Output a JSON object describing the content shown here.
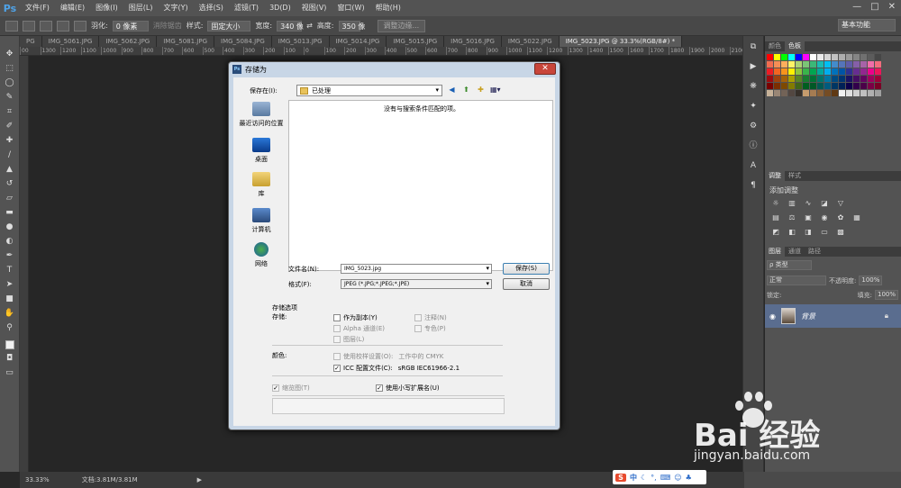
{
  "app": {
    "logo": "Ps"
  },
  "menu": [
    "文件(F)",
    "编辑(E)",
    "图像(I)",
    "图层(L)",
    "文字(Y)",
    "选择(S)",
    "滤镜(T)",
    "3D(D)",
    "视图(V)",
    "窗口(W)",
    "帮助(H)"
  ],
  "window_controls": [
    "—",
    "□",
    "✕"
  ],
  "options_bar": {
    "feather_label": "羽化:",
    "feather_value": "0 像素",
    "antialias_label": "消除锯齿",
    "style_label": "样式:",
    "style_value": "固定大小",
    "width_label": "宽度:",
    "width_value": "340 像",
    "height_label": "高度:",
    "height_value": "350 像",
    "refine_button": "调整边缘...",
    "workspace": "基本功能"
  },
  "tabs": [
    {
      "label": "PG",
      "active": false
    },
    {
      "label": "IMG_5061.JPG",
      "active": false
    },
    {
      "label": "IMG_5062.JPG",
      "active": false
    },
    {
      "label": "IMG_5081.JPG",
      "active": false
    },
    {
      "label": "IMG_5084.JPG",
      "active": false
    },
    {
      "label": "IMG_5013.JPG",
      "active": false
    },
    {
      "label": "IMG_5014.JPG",
      "active": false
    },
    {
      "label": "IMG_5015.JPG",
      "active": false
    },
    {
      "label": "IMG_5016.JPG",
      "active": false
    },
    {
      "label": "IMG_5022.JPG",
      "active": false
    },
    {
      "label": "IMG_5023.JPG @ 33.3%(RGB/8#) *",
      "active": true
    }
  ],
  "ruler_ticks": [
    "00",
    "1300",
    "1200",
    "1100",
    "1000",
    "900",
    "800",
    "700",
    "600",
    "500",
    "400",
    "300",
    "200",
    "100",
    "0",
    "100",
    "200",
    "300",
    "400",
    "500",
    "600",
    "700",
    "800",
    "900",
    "1000",
    "1100",
    "1200",
    "1300",
    "1400",
    "1500",
    "1600",
    "1700",
    "1800",
    "1900",
    "2000",
    "2100"
  ],
  "status": {
    "zoom": "33.33%",
    "doc": "文档:3.81M/3.81M"
  },
  "panels": {
    "swatches_tabs": [
      "颜色",
      "色板"
    ],
    "adjust_tabs": [
      "调整",
      "样式"
    ],
    "adjust_title": "添加调整",
    "layers_tabs": [
      "图层",
      "通道",
      "路径"
    ],
    "kind_label": "ρ 类型",
    "blend_mode": "正常",
    "opacity_label": "不透明度:",
    "opacity_value": "100%",
    "lock_label": "锁定:",
    "fill_label": "填充:",
    "fill_value": "100%",
    "layer_name": "背景"
  },
  "dialog": {
    "title": "存储为",
    "close": "✕",
    "save_in_label": "保存在(I):",
    "save_in_value": "已处理",
    "empty_message": "没有与搜索条件匹配的项。",
    "places": [
      "最近访问的位置",
      "桌面",
      "库",
      "计算机",
      "网络"
    ],
    "filename_label": "文件名(N):",
    "filename_value": "IMG_5023.jpg",
    "format_label": "格式(F):",
    "format_value": "JPEG (*.JPG;*.JPEG;*.JPE)",
    "save_button": "保存(S)",
    "cancel_button": "取消",
    "options_title": "存储选项",
    "store_label": "存储:",
    "as_copy": "作为副本(Y)",
    "notes": "注释(N)",
    "alpha": "Alpha 通道(E)",
    "spot": "专色(P)",
    "layers": "图层(L)",
    "color_label": "颜色:",
    "use_proof": "使用校样设置(O):",
    "proof_value": "工作中的 CMYK",
    "icc": "ICC 配置文件(C):",
    "icc_value": "sRGB IEC61966-2.1",
    "thumbnail": "缩览图(T)",
    "lowercase_ext": "使用小写扩展名(U)"
  },
  "ime": {
    "logo": "S",
    "label": "中"
  },
  "watermark": {
    "brand": "Bai  经验",
    "url": "jingyan.baidu.com"
  },
  "swatch_colors": [
    "#ff0000",
    "#ffff00",
    "#00ff00",
    "#00ffff",
    "#0000ff",
    "#ff00ff",
    "#ffffff",
    "#ebebeb",
    "#d6d6d6",
    "#c2c2c2",
    "#adadad",
    "#999999",
    "#858585",
    "#707070",
    "#5c5c5c",
    "#474747",
    "#f26c4f",
    "#f68e55",
    "#fbaf5c",
    "#fff467",
    "#acd372",
    "#7cc576",
    "#3bb878",
    "#1abbb4",
    "#00bff3",
    "#438ccb",
    "#5574b9",
    "#605ca8",
    "#855fa8",
    "#a763a8",
    "#f06ea9",
    "#f26d7d",
    "#ed1c24",
    "#f26522",
    "#f7941d",
    "#fff200",
    "#8dc63f",
    "#39b54a",
    "#00a651",
    "#00a99d",
    "#00aeef",
    "#0072bc",
    "#0054a6",
    "#2e3192",
    "#662d91",
    "#92278f",
    "#ec008c",
    "#ed145b",
    "#9e0b0f",
    "#a0410d",
    "#a36209",
    "#aba000",
    "#598527",
    "#197b30",
    "#007236",
    "#00746b",
    "#0076a3",
    "#004a80",
    "#003471",
    "#1b1464",
    "#440e62",
    "#630460",
    "#9e005d",
    "#9e0039",
    "#790000",
    "#7b2e00",
    "#7d4900",
    "#827b00",
    "#406618",
    "#005e20",
    "#005826",
    "#005952",
    "#005b7f",
    "#003663",
    "#002157",
    "#0d004c",
    "#32004b",
    "#4b0049",
    "#7b0046",
    "#7a0026",
    "#c7b299",
    "#998675",
    "#736357",
    "#534741",
    "#37302a",
    "#c69c6d",
    "#a67c52",
    "#8c6239",
    "#754c24",
    "#603913",
    "#f0f0f0",
    "#e0e0e0",
    "#d0d0d0",
    "#c0c0c0",
    "#b0b0b0",
    "#a0a0a0"
  ]
}
